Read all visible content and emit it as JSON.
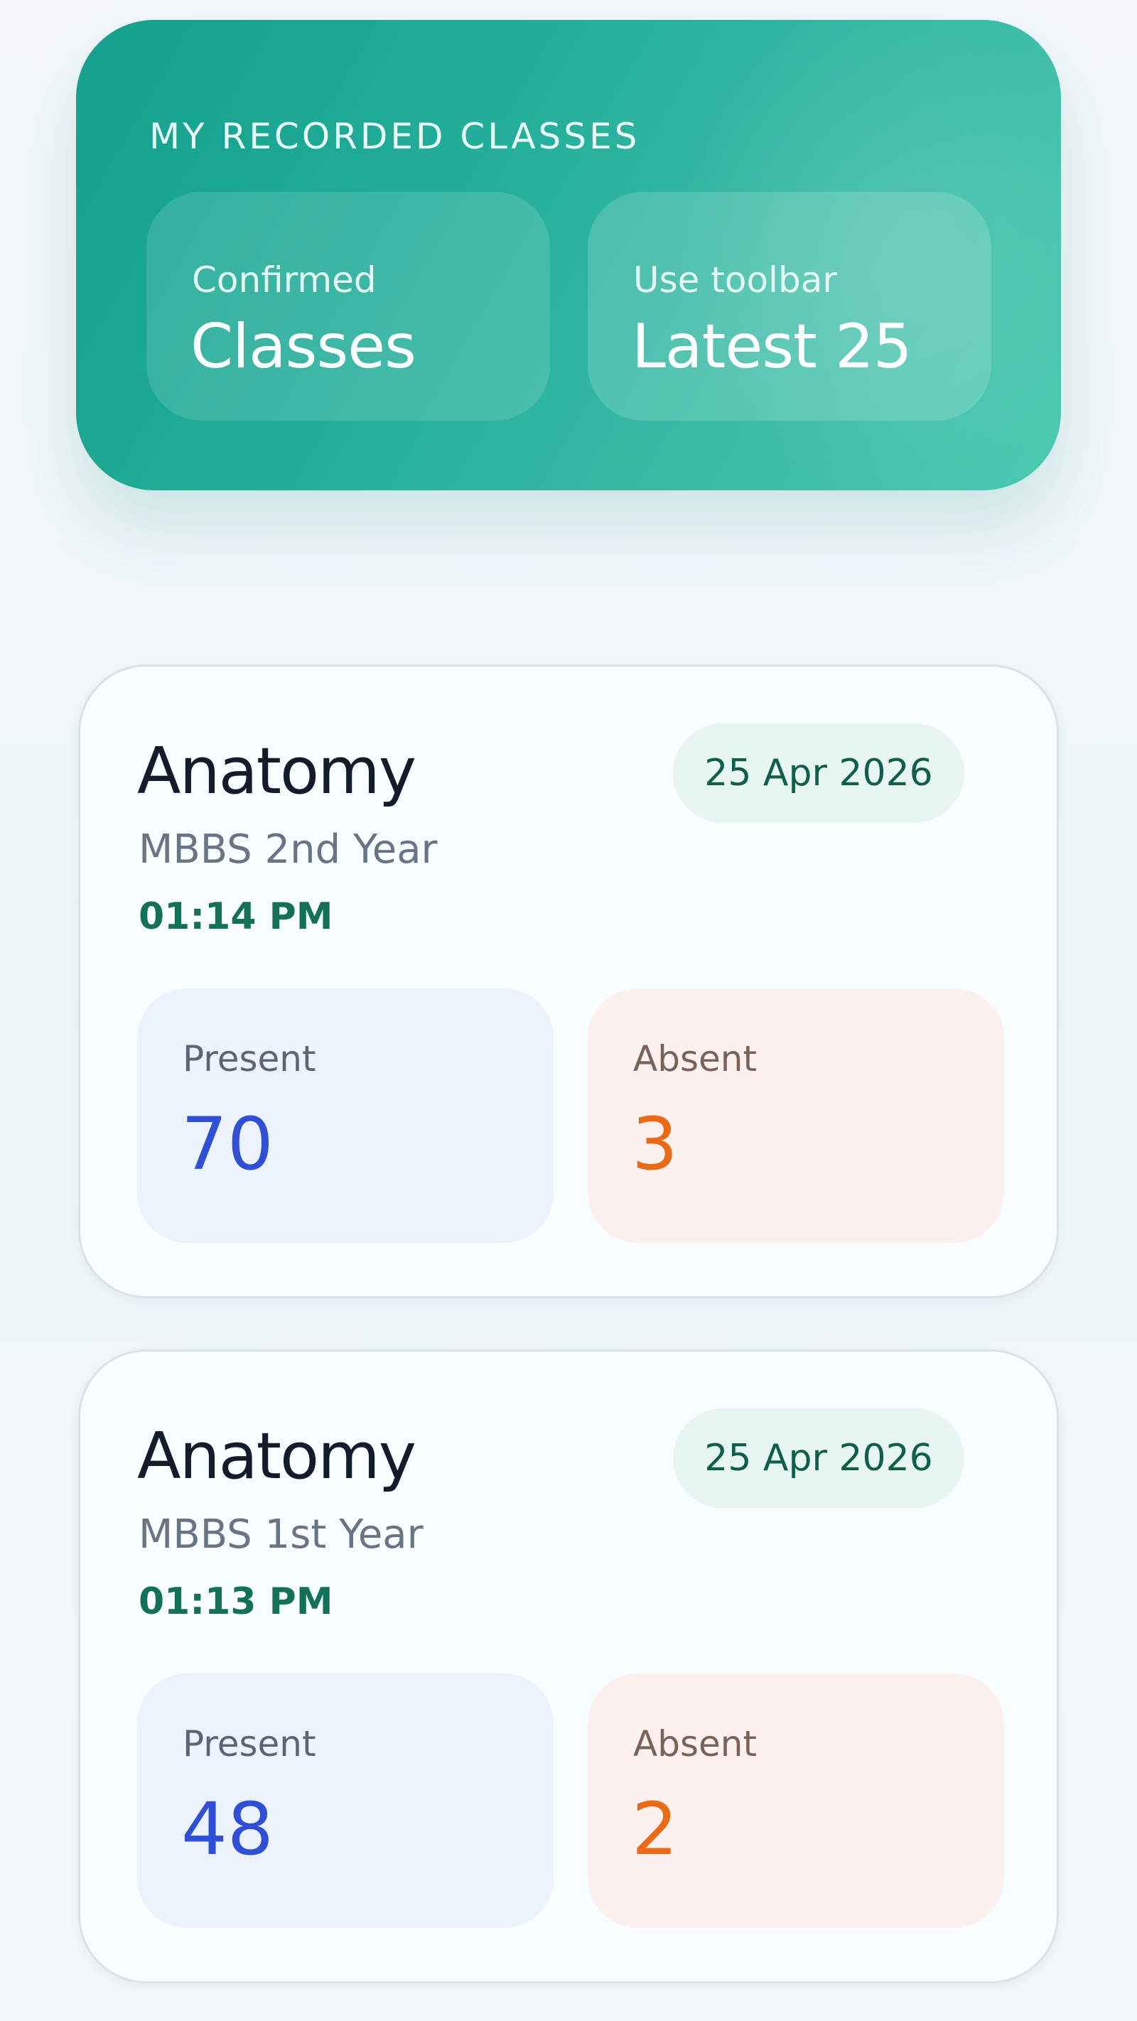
{
  "header": {
    "title": "MY RECORDED CLASSES",
    "stats": [
      {
        "sub": "Confirmed",
        "main": "Classes"
      },
      {
        "sub": "Use toolbar",
        "main": "Latest 25"
      }
    ]
  },
  "classes": [
    {
      "subject": "Anatomy",
      "date": "25 Apr 2026",
      "course": "MBBS 2nd Year",
      "time": "01:14 PM",
      "present_label": "Present",
      "present": "70",
      "absent_label": "Absent",
      "absent": "3"
    },
    {
      "subject": "Anatomy",
      "date": "25 Apr 2026",
      "course": "MBBS 1st Year",
      "time": "01:13 PM",
      "present_label": "Present",
      "present": "48",
      "absent_label": "Absent",
      "absent": "2"
    }
  ],
  "colors": {
    "accent_teal": "#21ad98",
    "present_blue": "#2e4fd6",
    "absent_orange": "#ec6a16",
    "time_green": "#137059"
  }
}
